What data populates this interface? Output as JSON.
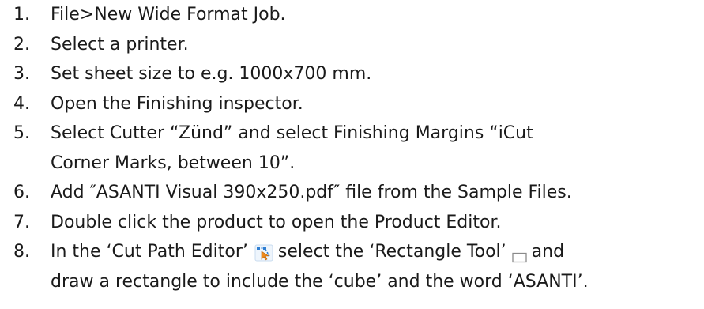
{
  "steps": [
    {
      "number": "1.",
      "text": "File>New Wide Format Job."
    },
    {
      "number": "2.",
      "text": "Select a printer."
    },
    {
      "number": "3.",
      "text": "Set sheet size to e.g. 1000x700 mm."
    },
    {
      "number": "4.",
      "text": "Open the Finishing inspector."
    },
    {
      "number": "5.",
      "line1": "Select Cutter “Zünd” and select Finishing Margins “iCut",
      "line2": "Corner Marks, between 10”."
    },
    {
      "number": "6.",
      "text": "Add ″ASANTI Visual 390x250.pdf″ file from the Sample Files."
    },
    {
      "number": "7.",
      "text": "Double click the product to open the Product Editor."
    },
    {
      "number": "8.",
      "part1": "In the ‘Cut Path Editor’",
      "part2": "select the ‘Rectangle Tool’",
      "part3": "and",
      "line2": "draw a rectangle to include the ‘cube’ and the word ‘ASANTI’."
    }
  ],
  "icons": {
    "cut_path_editor": "cut-path-editor-icon",
    "rectangle_tool": "rectangle-tool-icon"
  },
  "colors": {
    "text": "#1a1a1a",
    "icon_blue": "#2f7fd3",
    "icon_orange": "#f08a1c",
    "icon_gray": "#8a8a8a"
  }
}
